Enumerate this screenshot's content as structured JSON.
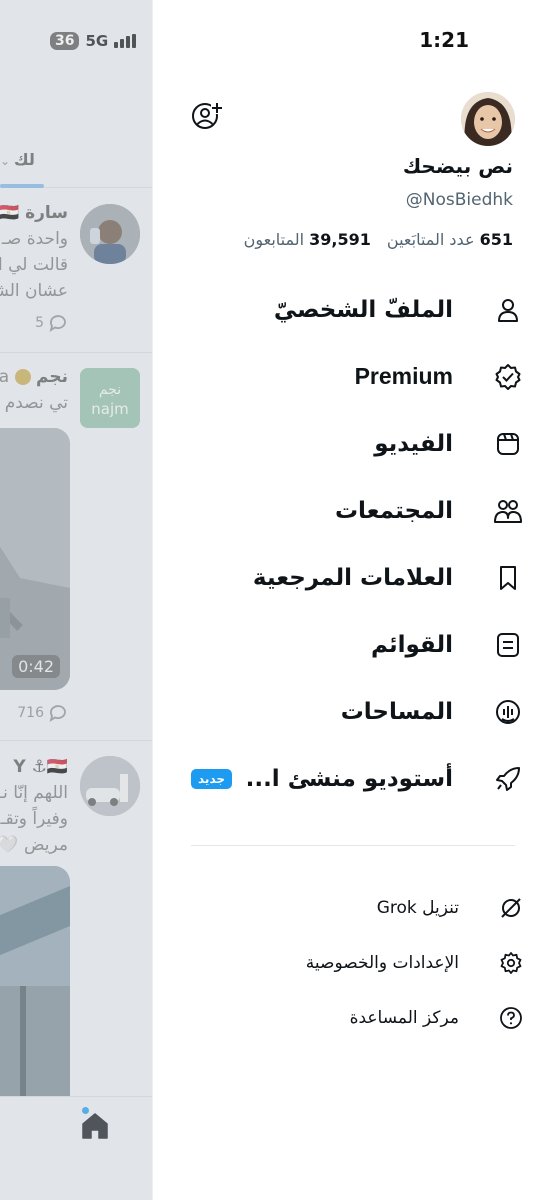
{
  "status_bar": {
    "time": "1:21",
    "battery": "36",
    "network": "5G"
  },
  "timeline": {
    "tab_label": "لك",
    "tweets": [
      {
        "name": "سارة 🇪🇬",
        "lines": [
          "واحدة صـ",
          "قالت لي ا",
          "عشان الشـ"
        ],
        "reply_count": "5"
      },
      {
        "name": "نجم",
        "handle": "a",
        "lines": [
          "تي نصدم"
        ],
        "avatar_text": "نجم najm",
        "video_duration": "0:42",
        "reply_count": "716"
      },
      {
        "name": "Y ⚓🇪🇬",
        "lines": [
          "اللهم إنّا نـ",
          "وفيراً وتقـ",
          "مريض 🤍"
        ]
      }
    ]
  },
  "drawer": {
    "profile": {
      "display_name": "نص بيضحك",
      "handle": "@NosBiedhk",
      "following_count": "651",
      "following_label": "عدد المتابَعين",
      "followers_count": "39,591",
      "followers_label": "المتابعون"
    },
    "menu": [
      {
        "key": "profile",
        "label": "الملفّ الشخصيّ",
        "icon": "person-icon"
      },
      {
        "key": "premium",
        "label": "Premium",
        "icon": "verified-badge-icon"
      },
      {
        "key": "video",
        "label": "الفيديو",
        "icon": "video-icon"
      },
      {
        "key": "communities",
        "label": "المجتمعات",
        "icon": "communities-icon"
      },
      {
        "key": "bookmarks",
        "label": "العلامات المرجعية",
        "icon": "bookmark-icon"
      },
      {
        "key": "lists",
        "label": "القوائم",
        "icon": "list-icon"
      },
      {
        "key": "spaces",
        "label": "المساحات",
        "icon": "spaces-icon"
      },
      {
        "key": "creator_studio",
        "label": "أستوديو منشئ ا...",
        "icon": "rocket-icon",
        "badge": "جديد"
      }
    ],
    "secondary": [
      {
        "key": "grok",
        "label": "تنزيل Grok",
        "icon": "grok-icon"
      },
      {
        "key": "settings",
        "label": "الإعدادات والخصوصية",
        "icon": "gear-icon"
      },
      {
        "key": "help",
        "label": "مركز المساعدة",
        "icon": "help-icon"
      }
    ]
  },
  "colors": {
    "accent": "#1d9bf0",
    "text_primary": "#0f1419",
    "text_secondary": "#536471"
  }
}
